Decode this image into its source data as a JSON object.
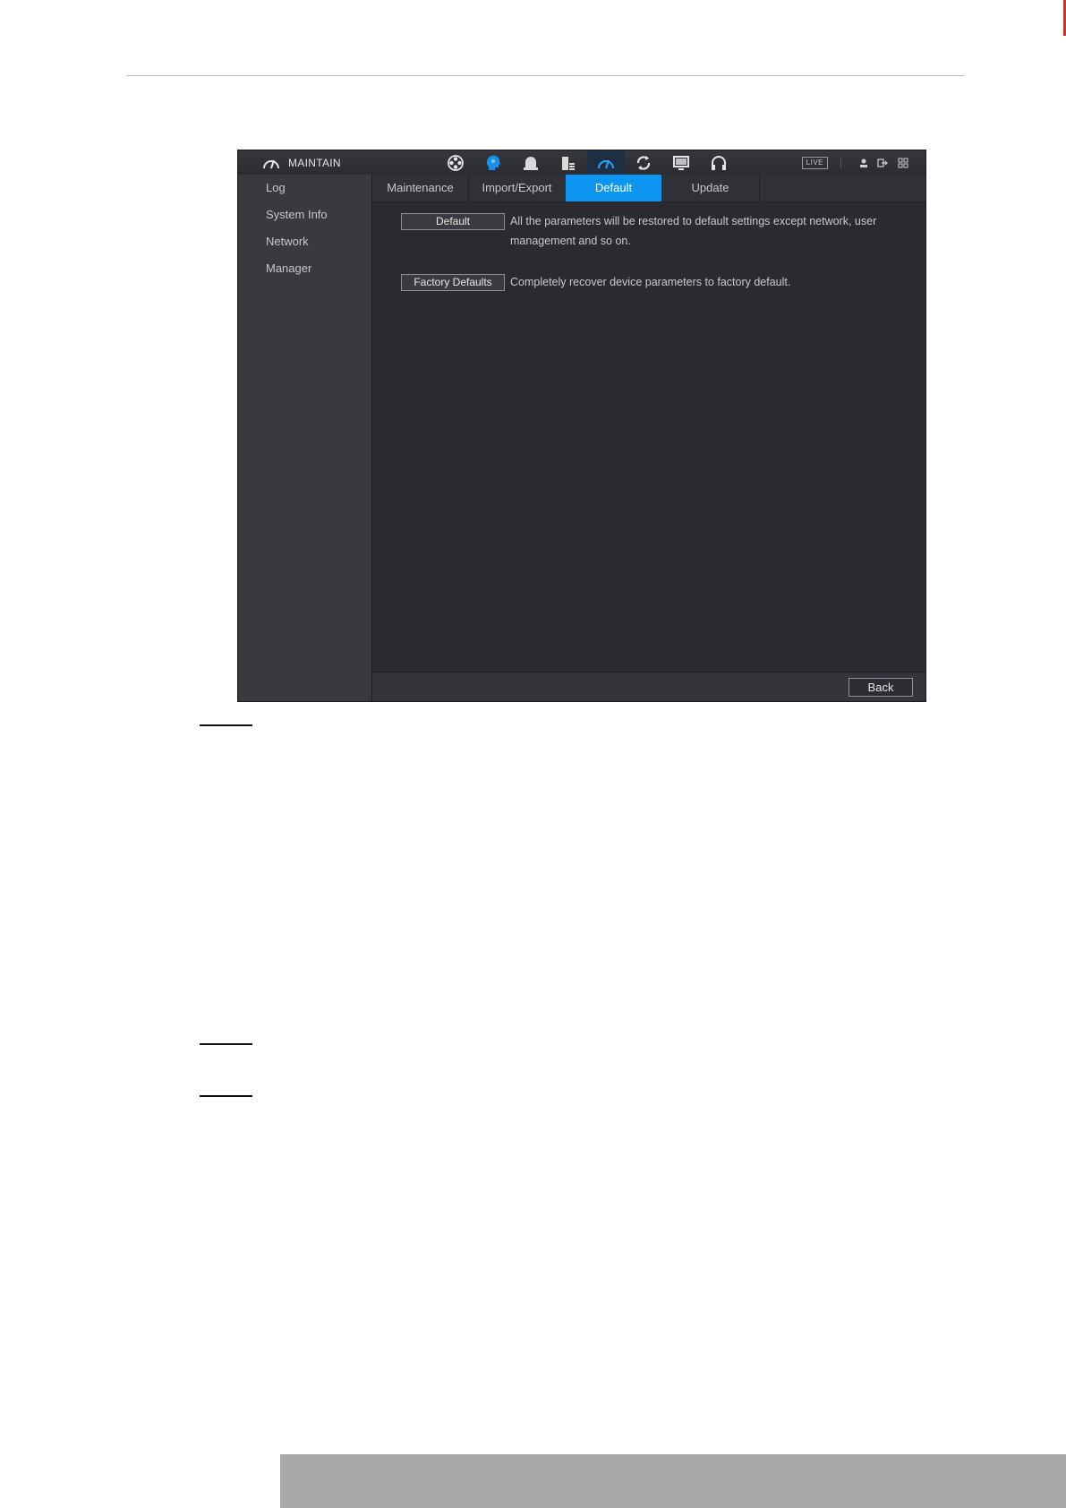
{
  "app": {
    "title": "MAINTAIN"
  },
  "topbar": {
    "nav_icons": [
      "camera-reel-icon",
      "ai-head-icon",
      "alarm-bell-icon",
      "storage-icon",
      "maintain-gauge-icon",
      "sync-icon",
      "display-icon",
      "audio-headphones-icon"
    ],
    "active_icon": "maintain-gauge-icon",
    "live_label": "LIVE",
    "tools": [
      "user-icon",
      "logout-icon",
      "grid-icon"
    ]
  },
  "sidebar": {
    "items": [
      {
        "label": "Log"
      },
      {
        "label": "System Info"
      },
      {
        "label": "Network"
      },
      {
        "label": "Manager"
      }
    ]
  },
  "tabs": [
    {
      "label": "Maintenance"
    },
    {
      "label": "Import/Export"
    },
    {
      "label": "Default"
    },
    {
      "label": "Update"
    }
  ],
  "active_tab": "Default",
  "content": {
    "default_button": "Default",
    "default_desc_line1": "All the parameters will be restored to default settings except network, user",
    "default_desc_line2": "management and so on.",
    "factory_button": "Factory Defaults",
    "factory_desc": "Completely recover device parameters to factory default."
  },
  "footer": {
    "back_label": "Back"
  },
  "colors": {
    "accent": "#0c96f2",
    "sidebar_bg": "#393a40",
    "content_bg": "#2a2b30"
  }
}
